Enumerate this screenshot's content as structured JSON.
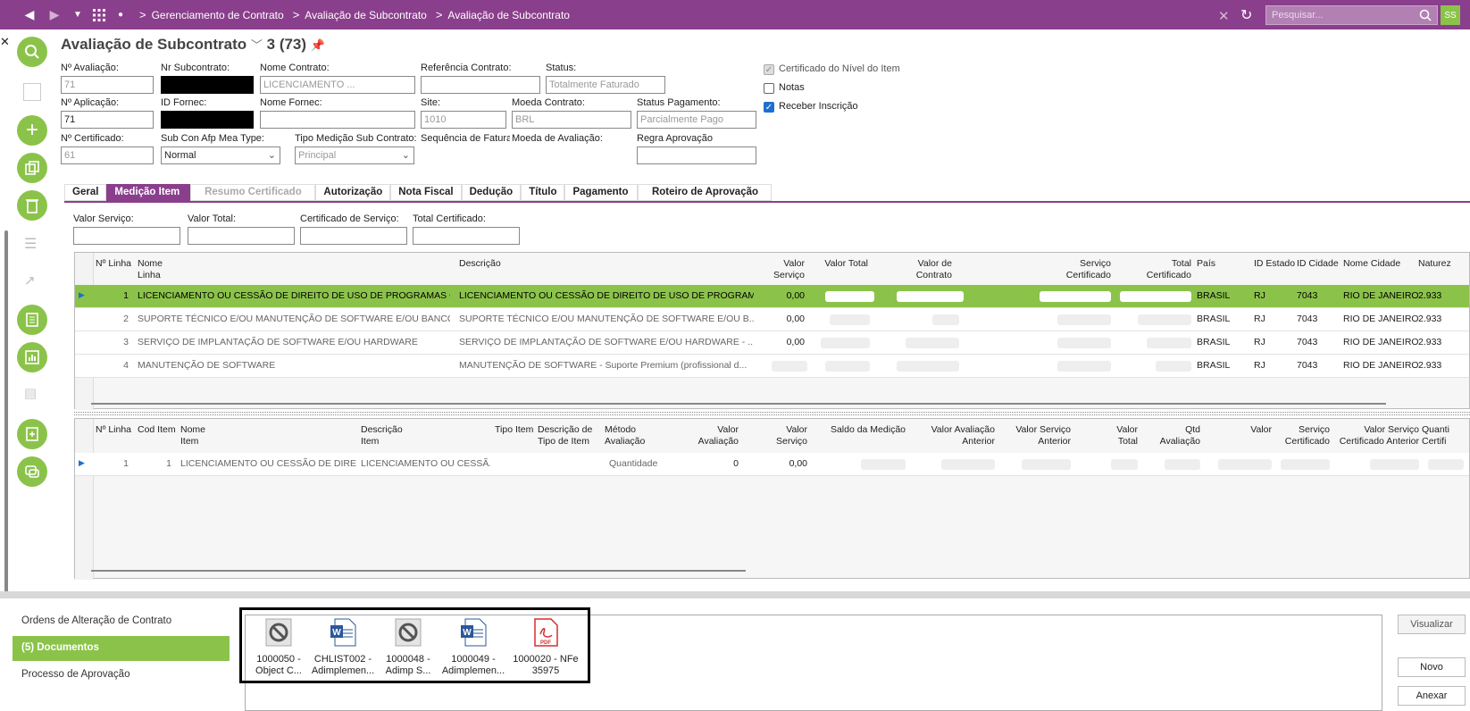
{
  "topbar": {
    "breadcrumbs": [
      "Gerenciamento de Contrato",
      "Avaliação de Subcontrato",
      "Avaliação de Subcontrato"
    ],
    "search_placeholder": "Pesquisar...",
    "user_initials": "SS",
    "accent": "#8a3f8c"
  },
  "page": {
    "title": "Avaliação de Subcontrato",
    "count": "3 (73)"
  },
  "form": {
    "n_avaliacao": {
      "label": "Nº Avaliação:",
      "value": "71"
    },
    "nr_subcontrato": {
      "label": "Nr Subcontrato:",
      "value": ""
    },
    "nome_contrato": {
      "label": "Nome Contrato:",
      "value": "LICENCIAMENTO ..."
    },
    "referencia_contrato": {
      "label": "Referência Contrato:",
      "value": ""
    },
    "status": {
      "label": "Status:",
      "value": "Totalmente Faturado"
    },
    "n_aplicacao": {
      "label": "Nº Aplicação:",
      "value": "71"
    },
    "id_fornec": {
      "label": "ID Fornec:",
      "value": ""
    },
    "nome_fornec": {
      "label": "Nome Fornec:",
      "value": ""
    },
    "site": {
      "label": "Site:",
      "value": "1010"
    },
    "moeda_contrato": {
      "label": "Moeda Contrato:",
      "value": "BRL"
    },
    "status_pagamento": {
      "label": "Status Pagamento:",
      "value": "Parcialmente Pago"
    },
    "n_certificado": {
      "label": "Nº Certificado:",
      "value": "61"
    },
    "sub_con_type": {
      "label": "Sub Con Afp Mea Type:",
      "value": "Normal"
    },
    "tipo_medicao": {
      "label": "Tipo Medição Sub Contrato:",
      "value": "Principal"
    },
    "sequencia_faturar": {
      "label": "Sequência de Faturar"
    },
    "moeda_avaliacao": {
      "label": "Moeda de Avaliação:"
    },
    "regra_aprovacao": {
      "label": "Regra Aprovação",
      "value": ""
    },
    "cb_certificado": "Certificado do Nível do Item",
    "cb_notas": "Notas",
    "cb_receber": "Receber Inscrição"
  },
  "tabs": [
    "Geral",
    "Medição Item",
    "Resumo Certificado",
    "Autorização",
    "Nota Fiscal",
    "Dedução",
    "Título",
    "Pagamento",
    "Roteiro de Aprovação"
  ],
  "totals": {
    "valor_servico": "Valor Serviço:",
    "valor_total": "Valor Total:",
    "certificado_servico": "Certificado de Serviço:",
    "total_certificado": "Total Certificado:"
  },
  "grid1": {
    "headers": [
      "Nº Linha",
      "Nome Linha",
      "Descrição",
      "Valor Serviço",
      "Valor Total",
      "Valor de Contrato",
      "Serviço Certificado",
      "Total Certificado",
      "País",
      "ID Estado",
      "ID Cidade",
      "Nome Cidade",
      "Naturez"
    ],
    "rows": [
      {
        "n": "1",
        "nome": "LICENCIAMENTO OU CESSÃO DE DIREITO DE USO DE PROGRAMAS C...",
        "desc": "LICENCIAMENTO OU CESSÃO DE DIREITO DE USO DE PROGRAM...",
        "valor_servico": "0,00",
        "pais": "BRASIL",
        "estado": "RJ",
        "cidade_id": "7043",
        "cidade": "RIO DE JANEIRO",
        "nat": "2.933"
      },
      {
        "n": "2",
        "nome": "SUPORTE TÉCNICO E/OU MANUTENÇÃO DE SOFTWARE E/OU BANCO ...",
        "desc": "SUPORTE TÉCNICO E/OU MANUTENÇÃO DE SOFTWARE E/OU B...",
        "valor_servico": "0,00",
        "pais": "BRASIL",
        "estado": "RJ",
        "cidade_id": "7043",
        "cidade": "RIO DE JANEIRO",
        "nat": "2.933"
      },
      {
        "n": "3",
        "nome": "SERVIÇO DE IMPLANTAÇÃO DE SOFTWARE E/OU HARDWARE",
        "desc": "SERVIÇO DE IMPLANTAÇÃO DE SOFTWARE E/OU HARDWARE - ...",
        "valor_servico": "0,00",
        "pais": "BRASIL",
        "estado": "RJ",
        "cidade_id": "7043",
        "cidade": "RIO DE JANEIRO",
        "nat": "2.933"
      },
      {
        "n": "4",
        "nome": "MANUTENÇÃO DE SOFTWARE",
        "desc": "MANUTENÇÃO DE SOFTWARE - Suporte Premium (profissional d...",
        "valor_servico": "",
        "pais": "BRASIL",
        "estado": "RJ",
        "cidade_id": "7043",
        "cidade": "RIO DE JANEIRO",
        "nat": "2.933"
      }
    ]
  },
  "grid2": {
    "headers": [
      "Nº Linha",
      "Cod Item",
      "Nome Item",
      "Descrição Item",
      "Tipo Item",
      "Descrição de Tipo de Item",
      "Método Avaliação",
      "Valor Avaliação",
      "Valor Serviço",
      "Saldo da Medição",
      "Valor Avaliação Anterior",
      "Valor Serviço Anterior",
      "Valor Total",
      "Qtd Avaliação",
      "Valor",
      "Serviço Certificado",
      "Valor Serviço Certificado Anterior",
      "Quanti Certifi"
    ],
    "row": {
      "n": "1",
      "cod": "1",
      "nome": "LICENCIAMENTO OU CESSÃO DE DIREIT...",
      "desc": "LICENCIAMENTO OU CESSÃ...",
      "metodo": "Quantidade",
      "valor_avaliacao": "0",
      "valor_servico": "0,00"
    }
  },
  "bottom_nav": [
    "Ordens de Alteração de Contrato",
    "(5) Documentos",
    "Processo de Aprovação"
  ],
  "documents": [
    {
      "line1": "1000050 -",
      "line2": "Object C...",
      "icon": "blocked-icon"
    },
    {
      "line1": "CHLIST002 -",
      "line2": "Adimplemen...",
      "icon": "word-icon"
    },
    {
      "line1": "1000048 -",
      "line2": "Adimp S...",
      "icon": "blocked-icon"
    },
    {
      "line1": "1000049 -",
      "line2": "Adimplemen...",
      "icon": "word-icon"
    },
    {
      "line1": "1000020 - NFe",
      "line2": "35975",
      "icon": "pdf-icon"
    }
  ],
  "side_buttons": [
    "Visualizar",
    "Novo",
    "Anexar"
  ]
}
